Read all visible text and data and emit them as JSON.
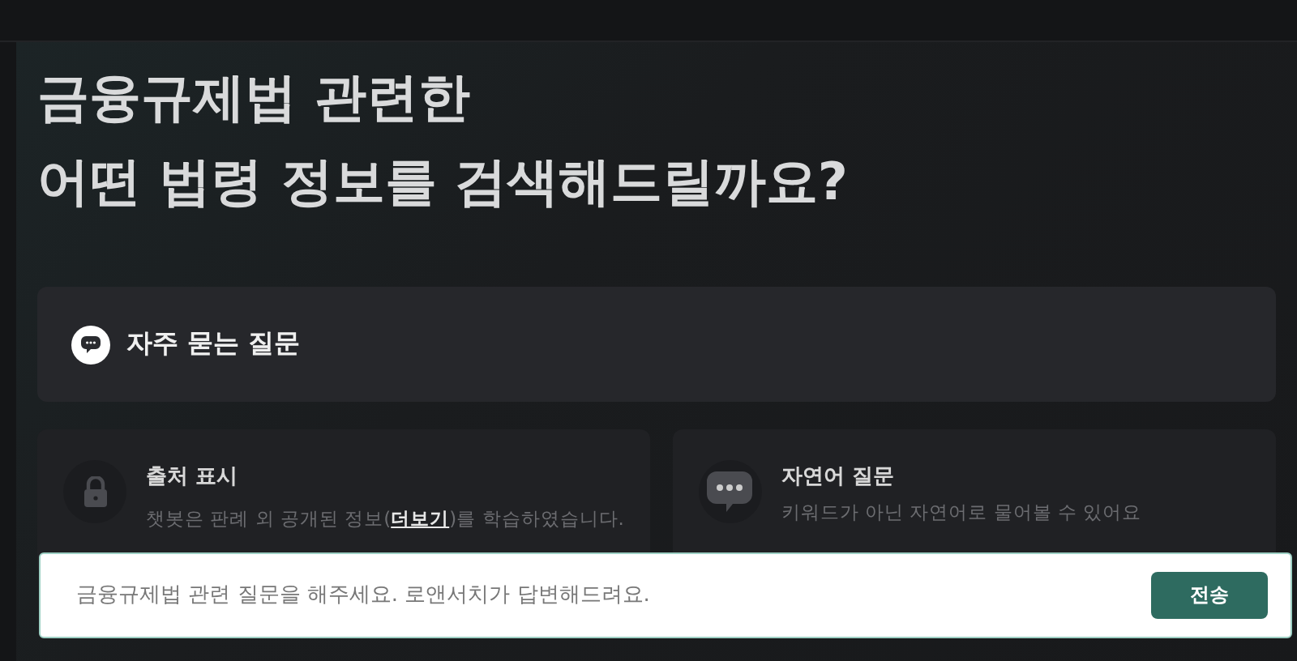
{
  "heading": [
    "금융규제법 관련한",
    "어떤 법령 정보를 검색해드릴까요?"
  ],
  "faq": {
    "label": "자주 묻는 질문"
  },
  "features": [
    {
      "kind": "lock",
      "title": "출처 표시",
      "description": "챗봇은 판례 외 공개된 정보(",
      "link": "더보기",
      "description_end": ")를 학습하였습니다."
    },
    {
      "kind": "chat",
      "title": "자연어 질문",
      "description": "키워드가 아닌 자연어로 물어볼 수 있어요"
    }
  ],
  "input": {
    "placeholder": "금융규제법 관련 질문을 해주세요. 로앤서치가 답변해드려요.",
    "button": "전송"
  }
}
